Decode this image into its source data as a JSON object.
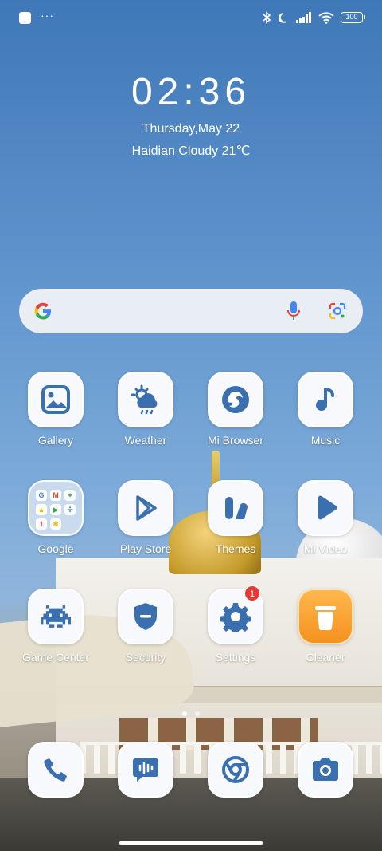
{
  "status_bar": {
    "left_icons": [
      "notification-square-icon",
      "more-dots-icon"
    ],
    "more_dots": "···",
    "right_icons": [
      "bluetooth-icon",
      "moon-icon",
      "signal-icon",
      "wifi-icon"
    ],
    "battery": "100"
  },
  "clock_widget": {
    "time": "02:36",
    "date": "Thursday,May 22",
    "weather": "Haidian Cloudy 21℃"
  },
  "search_bar": {
    "icons": [
      "google-logo-icon",
      "microphone-icon",
      "google-lens-icon"
    ]
  },
  "apps": [
    {
      "label": "Gallery",
      "icon": "gallery-icon"
    },
    {
      "label": "Weather",
      "icon": "weather-icon"
    },
    {
      "label": "Mi Browser",
      "icon": "browser-icon"
    },
    {
      "label": "Music",
      "icon": "music-icon"
    },
    {
      "label": "Google",
      "icon": "folder-icon"
    },
    {
      "label": "Play Store",
      "icon": "play-store-icon"
    },
    {
      "label": "Themes",
      "icon": "themes-icon"
    },
    {
      "label": "Mi Video",
      "icon": "video-icon"
    },
    {
      "label": "Game Center",
      "icon": "game-center-icon"
    },
    {
      "label": "Security",
      "icon": "shield-icon"
    },
    {
      "label": "Settings",
      "icon": "gear-icon",
      "badge": "1"
    },
    {
      "label": "Cleaner",
      "icon": "trash-icon"
    }
  ],
  "folder_letters": [
    "G",
    "M",
    "⌖",
    "▲",
    "▶",
    "✣",
    "1",
    "✱"
  ],
  "pager": {
    "pages": 2,
    "current": 1
  },
  "dock": [
    {
      "icon": "phone-icon"
    },
    {
      "icon": "messages-icon"
    },
    {
      "icon": "chrome-icon"
    },
    {
      "icon": "camera-icon"
    }
  ],
  "colors": {
    "icon_blue": "#3a6fb0",
    "badge_red": "#e53935",
    "cleaner_orange": "#f5911f"
  }
}
